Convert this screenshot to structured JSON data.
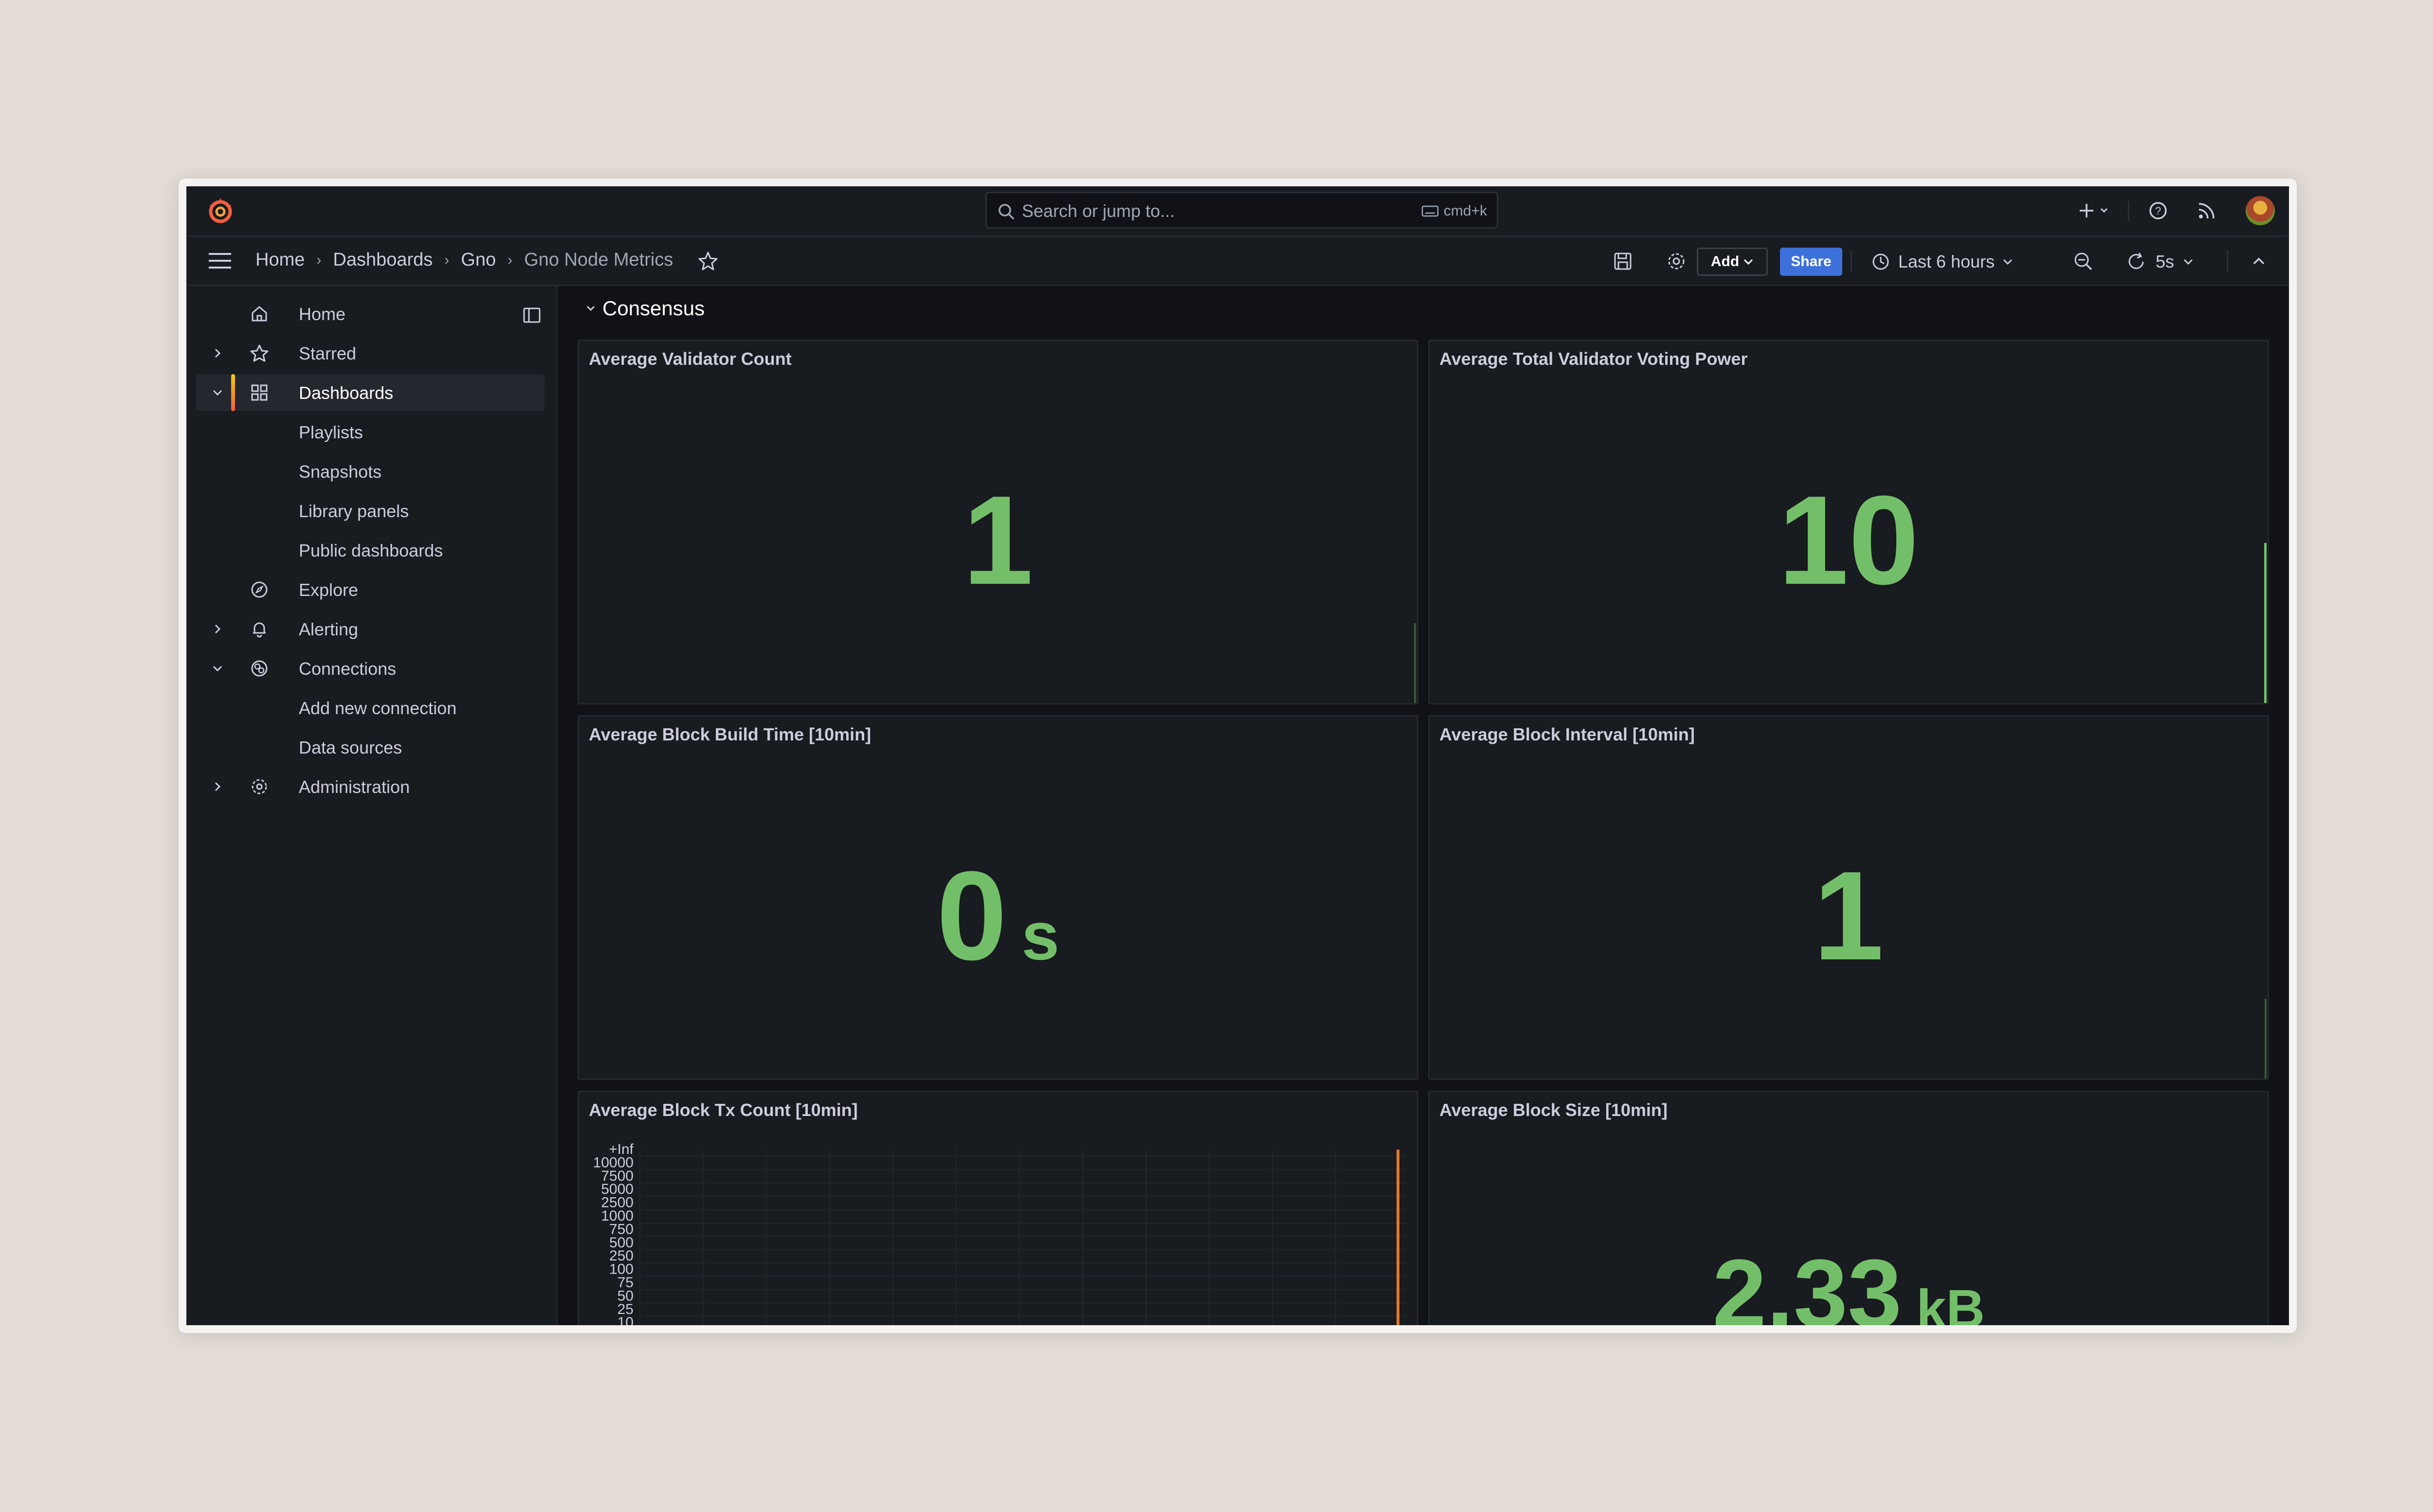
{
  "search": {
    "placeholder": "Search or jump to...",
    "shortcut": "cmd+k"
  },
  "breadcrumb": [
    "Home",
    "Dashboards",
    "Gno",
    "Gno Node Metrics"
  ],
  "toolbar": {
    "add_label": "Add",
    "share_label": "Share",
    "time_range": "Last 6 hours",
    "refresh_interval": "5s"
  },
  "sidebar": {
    "items": [
      {
        "label": "Home"
      },
      {
        "label": "Starred"
      },
      {
        "label": "Dashboards"
      },
      {
        "label": "Playlists"
      },
      {
        "label": "Snapshots"
      },
      {
        "label": "Library panels"
      },
      {
        "label": "Public dashboards"
      },
      {
        "label": "Explore"
      },
      {
        "label": "Alerting"
      },
      {
        "label": "Connections"
      },
      {
        "label": "Add new connection"
      },
      {
        "label": "Data sources"
      },
      {
        "label": "Administration"
      }
    ]
  },
  "row": {
    "title": "Consensus"
  },
  "panels": [
    {
      "title": "Average Validator Count",
      "value": "1",
      "unit": ""
    },
    {
      "title": "Average Total Validator Voting Power",
      "value": "10",
      "unit": ""
    },
    {
      "title": "Average Block Build Time [10min]",
      "value": "0",
      "unit": "s"
    },
    {
      "title": "Average Block Interval [10min]",
      "value": "1",
      "unit": ""
    },
    {
      "title": "Average Block Tx Count [10min]",
      "yticks": [
        "+Inf",
        "10000",
        "7500",
        "5000",
        "2500",
        "1000",
        "750",
        "500",
        "250",
        "100",
        "75",
        "50",
        "25",
        "10"
      ]
    },
    {
      "title": "Average Block Size [10min]",
      "value": "2.33",
      "unit": "kB"
    }
  ],
  "colors": {
    "stat_green": "#73bf69",
    "accent_orange": "#f55f3e",
    "share_blue": "#3d71d9",
    "heatmap_bar": "#e0752d"
  },
  "icons": [
    "grafana-logo",
    "search-icon",
    "keyboard-icon",
    "plus-icon",
    "help-icon",
    "rss-icon",
    "menu-icon",
    "star-icon",
    "save-icon",
    "gear-icon",
    "clock-icon",
    "zoom-out-icon",
    "refresh-icon",
    "collapse-icon",
    "home-icon",
    "grid-icon",
    "compass-icon",
    "bell-icon",
    "connections-icon",
    "dock-icon"
  ]
}
